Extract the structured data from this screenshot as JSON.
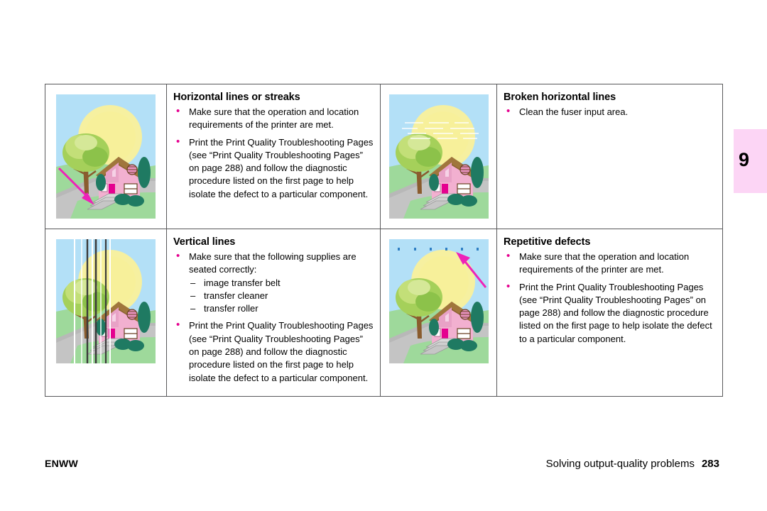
{
  "page": {
    "chapter_tab": "9",
    "chapter_tab_color": "#fcd5f5",
    "bullet_color": "#e5008f",
    "border_color": "#58585a"
  },
  "table": {
    "cells": [
      {
        "id": "horizontal-lines-or-streaks",
        "heading": "Horizontal lines or streaks",
        "bullets": [
          "Make sure that the operation and location requirements of the printer are met.",
          "Print the Print Quality Troubleshooting Pages (see “Print Quality Troubleshooting Pages” on page 288) and follow the diagnostic procedure listed on the first page to help isolate the defect to a particular component."
        ],
        "image_alt": "house-scene-horizontal-streaks"
      },
      {
        "id": "broken-horizontal-lines",
        "heading": "Broken horizontal lines",
        "bullets": [
          "Clean the fuser input area."
        ],
        "image_alt": "house-scene-broken-horizontal-lines"
      },
      {
        "id": "vertical-lines",
        "heading": "Vertical lines",
        "bullets": [
          "Make sure that the following supplies are seated correctly:",
          "Print the Print Quality Troubleshooting Pages (see “Print Quality Troubleshooting Pages” on page 288) and follow the diagnostic procedure listed on the first page to help isolate the defect to a particular component."
        ],
        "sub_items": [
          "image transfer belt",
          "transfer cleaner",
          "transfer roller"
        ],
        "image_alt": "house-scene-vertical-lines"
      },
      {
        "id": "repetitive-defects",
        "heading": "Repetitive defects",
        "bullets": [
          "Make sure that the operation and location requirements of the printer are met.",
          "Print the Print Quality Troubleshooting Pages (see “Print Quality Troubleshooting Pages” on page 288) and follow the diagnostic procedure listed on the first page to help isolate the defect to a particular component."
        ],
        "image_alt": "house-scene-repetitive-defects"
      }
    ]
  },
  "footer": {
    "left": "ENWW",
    "section": "Solving output-quality problems",
    "page_number": "283"
  }
}
